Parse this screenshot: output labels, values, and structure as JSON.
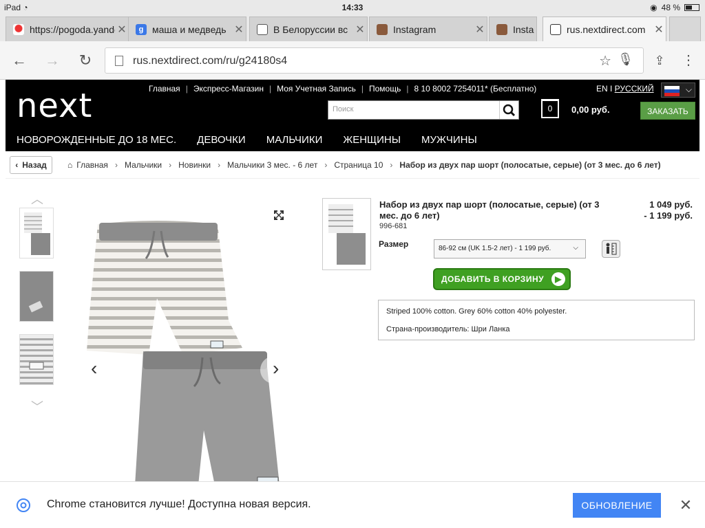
{
  "status": {
    "device": "iPad",
    "time": "14:33",
    "battery": "48 %"
  },
  "tabs": [
    {
      "title": "https://pogoda.yandex.ru",
      "icon": "weather-icon"
    },
    {
      "title": "маша и медведь",
      "icon": "google-icon"
    },
    {
      "title": "В Белоруссии вс",
      "icon": "doc-icon"
    },
    {
      "title": "Instagram",
      "icon": "instagram-icon"
    },
    {
      "title": "Insta",
      "icon": "instagram-icon"
    },
    {
      "title": "rus.nextdirect.com",
      "icon": "next-icon"
    }
  ],
  "address": {
    "url": "rus.nextdirect.com/ru/g24180s4"
  },
  "site": {
    "logo": "next",
    "top_links": [
      "Главная",
      "Экспресс-Магазин",
      "Моя Учетная Запись",
      "Помощь",
      "8 10 8002 7254011* (Бесплатно)"
    ],
    "lang_en": "EN I ",
    "lang_ru": "РУССКИЙ",
    "search_placeholder": "Поиск",
    "bag_count": "0",
    "bag_total": "0,00 руб.",
    "order_label": "ЗАКАЗАТЬ",
    "nav": [
      "НОВОРОЖДЕННЫЕ ДО 18 МЕС.",
      "ДЕВОЧКИ",
      "МАЛЬЧИКИ",
      "ЖЕНЩИНЫ",
      "МУЖЧИНЫ"
    ]
  },
  "breadcrumbs": {
    "back_label": "Назад",
    "items": [
      "Главная",
      "Мальчики",
      "Новинки",
      "Мальчики 3 мес. - 6 лет",
      "Страница 10"
    ],
    "current": "Набор из двух пар шорт (полосатые, серые) (от 3 мес. до 6 лет)"
  },
  "product": {
    "title": "Набор из двух пар шорт (полосатые, серые) (от 3 мес. до 6 лет)",
    "price_line1": "1 049 руб.",
    "price_line2": "- 1 199 руб.",
    "code": "996-681",
    "size_label": "Размер",
    "size_selected": "86-92 см (UK 1.5-2 лет) - 1 199 руб.",
    "add_to_cart": "ДОБАВИТЬ В КОРЗИНУ",
    "desc_line1": "Striped 100% cotton. Grey 60% cotton 40% polyester.",
    "desc_line2": "Страна-производитель: Шри Ланка"
  },
  "banner": {
    "message": "Chrome становится лучше! Доступна новая версия.",
    "button": "ОБНОВЛЕНИЕ"
  },
  "colors": {
    "brand_green": "#5a9e46",
    "cart_green": "#3fa022",
    "chrome_blue": "#4285f4"
  }
}
